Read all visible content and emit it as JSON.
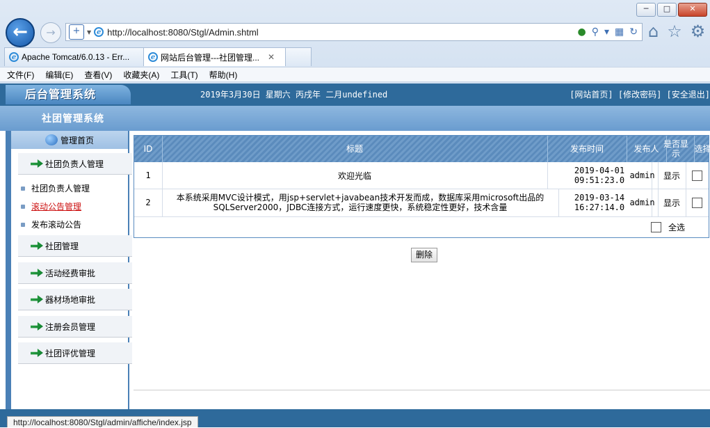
{
  "browser": {
    "url": "http://localhost:8080/Stgl/Admin.shtml",
    "tabs": [
      {
        "label": "Apache Tomcat/6.0.13 - Err..."
      },
      {
        "label": "网站后台管理---社团管理..."
      }
    ],
    "menu": [
      "文件(F)",
      "编辑(E)",
      "查看(V)",
      "收藏夹(A)",
      "工具(T)",
      "帮助(H)"
    ],
    "status_url": "http://localhost:8080/Stgl/admin/affiche/index.jsp"
  },
  "header": {
    "logo": "后台管理系统",
    "date": "2019年3月30日 星期六 丙戌年 二月undefined",
    "links": "[网站首页] [修改密码] [安全退出]",
    "system_name": "社团管理系统"
  },
  "sidebar": {
    "home": "管理首页",
    "categories": [
      "社团负责人管理",
      "社团管理",
      "活动经费审批",
      "器材场地审批",
      "注册会员管理",
      "社团评优管理"
    ],
    "subitems": [
      "社团负责人管理",
      "滚动公告管理",
      "发布滚动公告"
    ]
  },
  "table": {
    "headers": {
      "id": "ID",
      "title": "标题",
      "time": "发布时间",
      "author": "发布人",
      "show": "是否显示",
      "select": "选择"
    },
    "rows": [
      {
        "id": "1",
        "title": "欢迎光临",
        "time": "2019-04-01 09:51:23.0",
        "author": "admin",
        "show": "显示"
      },
      {
        "id": "2",
        "title": "本系统采用MVC设计模式，用jsp+servlet+javabean技术开发而成，数据库采用microsoft出品的SQLServer2000，JDBC连接方式，运行速度更快，系统稳定性更好，技术含量",
        "time": "2019-03-14 16:27:14.0",
        "author": "admin",
        "show": "显示"
      }
    ],
    "select_all": "全选",
    "delete_label": "删除"
  }
}
